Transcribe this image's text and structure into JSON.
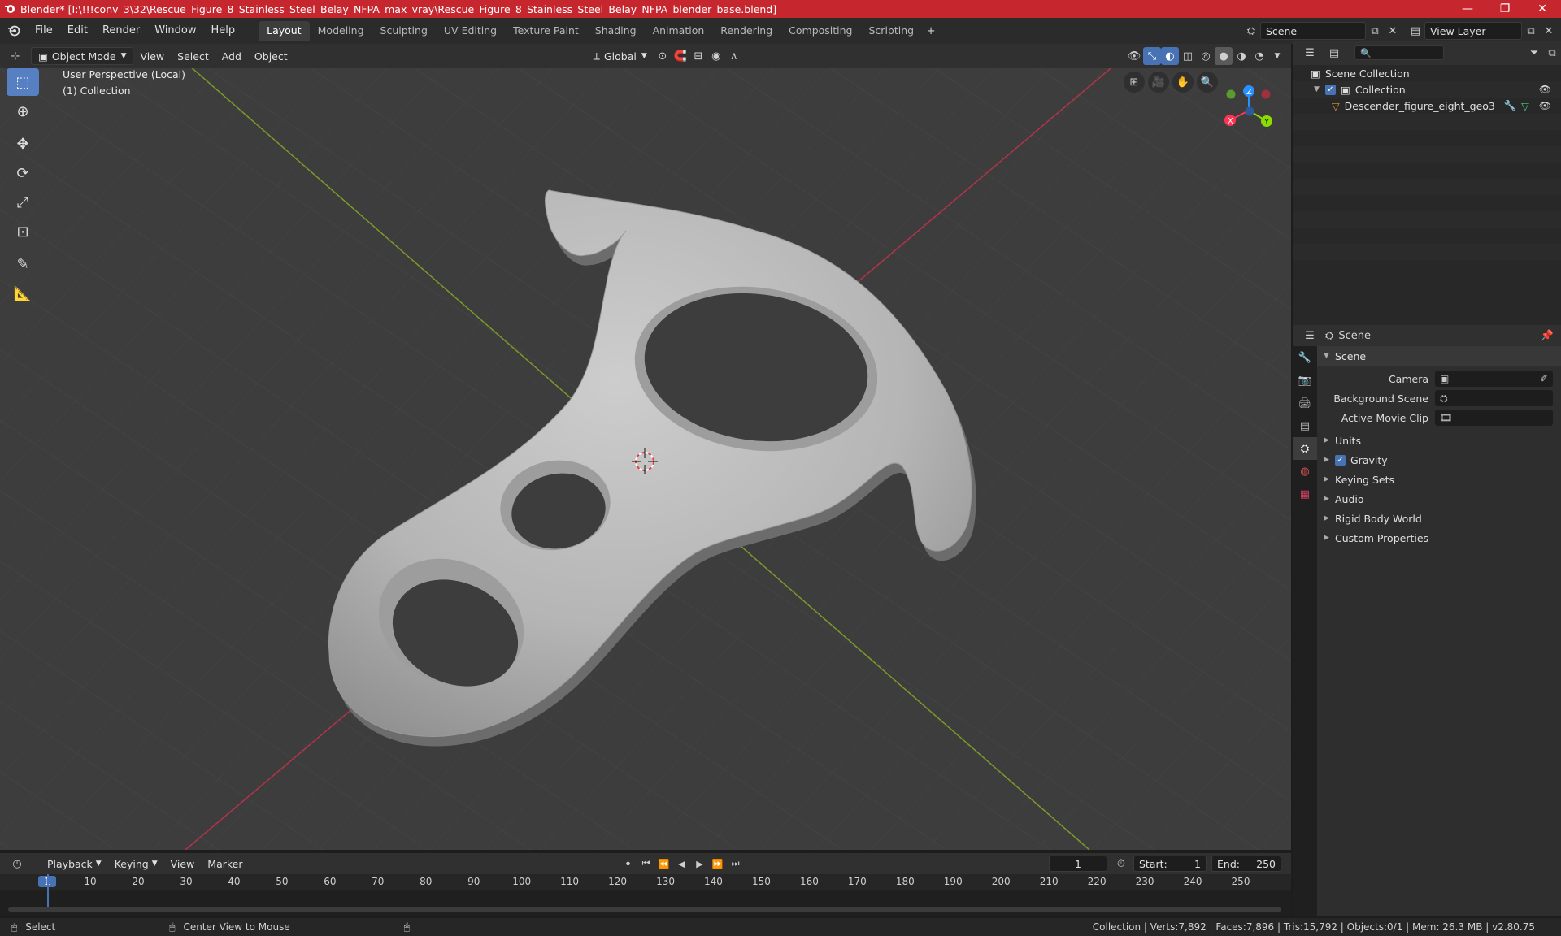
{
  "window": {
    "title": "Blender* [I:\\!!!conv_3\\32\\Rescue_Figure_8_Stainless_Steel_Belay_NFPA_max_vray\\Rescue_Figure_8_Stainless_Steel_Belay_NFPA_blender_base.blend]",
    "minimize": "—",
    "maximize": "❐",
    "close": "✕"
  },
  "menu": [
    "File",
    "Edit",
    "Render",
    "Window",
    "Help"
  ],
  "workspaces": [
    {
      "label": "Layout",
      "active": true
    },
    {
      "label": "Modeling"
    },
    {
      "label": "Sculpting"
    },
    {
      "label": "UV Editing"
    },
    {
      "label": "Texture Paint"
    },
    {
      "label": "Shading"
    },
    {
      "label": "Animation"
    },
    {
      "label": "Rendering"
    },
    {
      "label": "Compositing"
    },
    {
      "label": "Scripting"
    }
  ],
  "add_workspace": "+",
  "scene_field": "Scene",
  "view_layer_field": "View Layer",
  "viewport_header": {
    "mode": "Object Mode",
    "menus": [
      "View",
      "Select",
      "Add",
      "Object"
    ],
    "orientation": "Global"
  },
  "viewport": {
    "perspective": "User Perspective (Local)",
    "collection": "(1) Collection",
    "axis_x": "X",
    "axis_y": "Y",
    "axis_z": "Z"
  },
  "outliner": {
    "root": "Scene Collection",
    "collection": "Collection",
    "object": "Descender_figure_eight_geo3"
  },
  "properties": {
    "header": "Scene",
    "panel": "Scene",
    "camera_label": "Camera",
    "bg_scene_label": "Background Scene",
    "movie_clip_label": "Active Movie Clip",
    "sections": [
      {
        "label": "Units"
      },
      {
        "label": "Gravity",
        "checkbox": true
      },
      {
        "label": "Keying Sets"
      },
      {
        "label": "Audio"
      },
      {
        "label": "Rigid Body World"
      },
      {
        "label": "Custom Properties"
      }
    ]
  },
  "timeline": {
    "menus": [
      "Playback",
      "Keying",
      "View",
      "Marker"
    ],
    "current_frame": "1",
    "start_label": "Start:",
    "start": "1",
    "end_label": "End:",
    "end": "250",
    "ticks": [
      "1",
      "10",
      "20",
      "30",
      "40",
      "50",
      "60",
      "70",
      "80",
      "90",
      "100",
      "110",
      "120",
      "130",
      "140",
      "150",
      "160",
      "170",
      "180",
      "190",
      "200",
      "210",
      "220",
      "230",
      "240",
      "250"
    ]
  },
  "status": {
    "select": "Select",
    "center": "Center View to Mouse",
    "stats": "Collection | Verts:7,892 | Faces:7,896 | Tris:15,792 | Objects:0/1 | Mem: 26.3 MB | v2.80.75"
  },
  "colors": {
    "titlebar": "#c6262e",
    "active_blue": "#4772b3",
    "axis_red": "#ff3352",
    "axis_green": "#8bdc00",
    "axis_blue": "#2890ff"
  }
}
